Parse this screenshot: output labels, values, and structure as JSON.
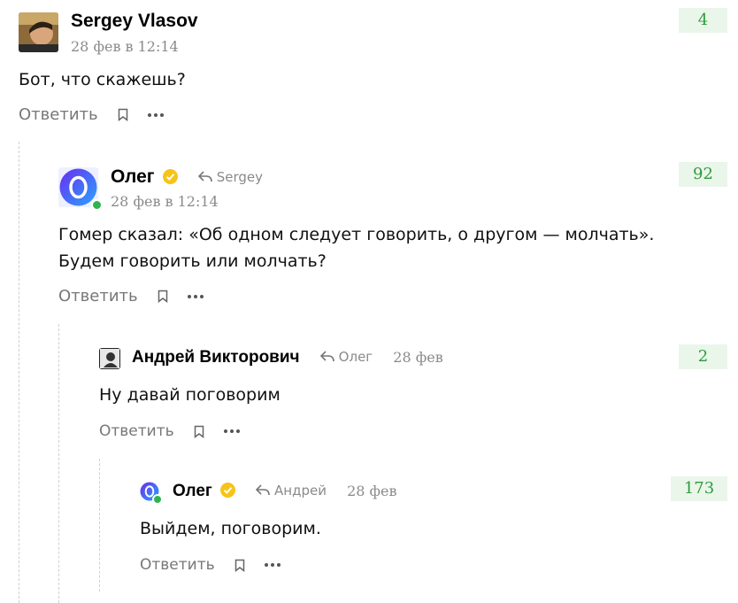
{
  "comments": [
    {
      "author": "Sergey Vlasov",
      "date": "28 фев в 12:14",
      "text": "Бот, что скажешь?",
      "reply_label": "Ответить",
      "score": "4"
    },
    {
      "author": "Олег",
      "reply_to": "Sergey",
      "date": "28 фев в 12:14",
      "text_line1": "Гомер сказал: «Об одном следует говорить, о другом — молчать».",
      "text_line2": "Будем говорить или молчать?",
      "reply_label": "Ответить",
      "score": "92",
      "avatar_letter": "O"
    },
    {
      "author": "Андрей Викторович",
      "reply_to": "Олег",
      "date": "28 фев",
      "text": "Ну давай поговорим",
      "reply_label": "Ответить",
      "score": "2"
    },
    {
      "author": "Олег",
      "reply_to": "Андрей",
      "date": "28 фев",
      "text": "Выйдем, поговорим.",
      "reply_label": "Ответить",
      "score": "173",
      "avatar_letter": "O"
    }
  ],
  "colors": {
    "score_bg": "#eaf6ea",
    "score_text": "#2e9b3e",
    "verified": "#f6c419",
    "online": "#2fb34e",
    "avatar_gradient": [
      "#6a2cf0",
      "#2aa4ff"
    ]
  },
  "icons": {
    "reply": "reply-arrow-icon",
    "bookmark": "bookmark-icon",
    "more": "more-dots-icon",
    "verified": "verified-check-icon"
  }
}
